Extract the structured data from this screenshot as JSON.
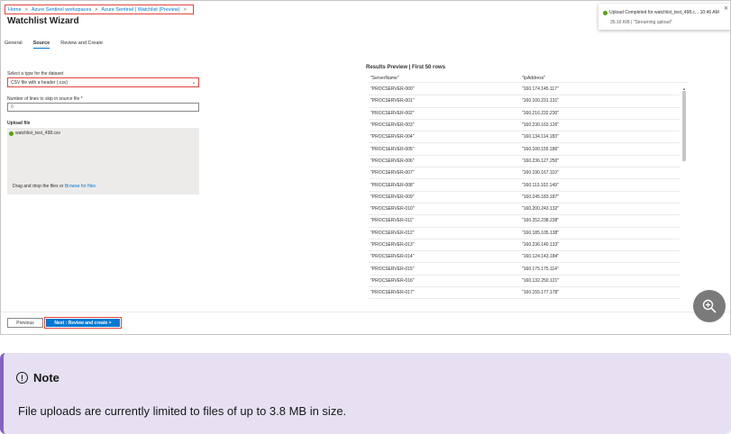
{
  "breadcrumb": [
    "Home",
    "Azure Sentinel workspaces",
    "Azure Sentinel | Watchlist (Preview)"
  ],
  "page_title": "Watchlist Wizard",
  "tabs": [
    {
      "label": "General",
      "active": false
    },
    {
      "label": "Source",
      "active": true
    },
    {
      "label": "Review and Create",
      "active": false
    }
  ],
  "form": {
    "type_label": "Select a type for the dataset",
    "type_value": "CSV file with a header (.csv)",
    "skip_label": "Number of lines to skip in source file *",
    "skip_value": "0",
    "upload_label": "Upload file",
    "uploaded_file": "watchlist_test_498.csv",
    "drop_text": "Drag and drop the files or",
    "browse_link": "Browse for files"
  },
  "results": {
    "title": "Results Preview | First 50 rows",
    "columns": [
      "\"ServerName\"",
      "\"IpAddress\""
    ],
    "rows": [
      [
        "\"PROCSERVER-000\"",
        "\"160.174.145.117\""
      ],
      [
        "\"PROCSERVER-001\"",
        "\"160.100.231.131\""
      ],
      [
        "\"PROCSERVER-002\"",
        "\"160.216.232.230\""
      ],
      [
        "\"PROCSERVER-003\"",
        "\"160.230.163.126\""
      ],
      [
        "\"PROCSERVER-004\"",
        "\"160.134.114.183\""
      ],
      [
        "\"PROCSERVER-005\"",
        "\"160.100.155.186\""
      ],
      [
        "\"PROCSERVER-006\"",
        "\"160.236.127.250\""
      ],
      [
        "\"PROCSERVER-007\"",
        "\"160.190.167.110\""
      ],
      [
        "\"PROCSERVER-008\"",
        "\"160.113.102.149\""
      ],
      [
        "\"PROCSERVER-009\"",
        "\"160.245.183.187\""
      ],
      [
        "\"PROCSERVER-010\"",
        "\"160.200.243.132\""
      ],
      [
        "\"PROCSERVER-011\"",
        "\"160.252.238.238\""
      ],
      [
        "\"PROCSERVER-012\"",
        "\"160.185.105.138\""
      ],
      [
        "\"PROCSERVER-013\"",
        "\"160.236.140.133\""
      ],
      [
        "\"PROCSERVER-014\"",
        "\"160.124.143.184\""
      ],
      [
        "\"PROCSERVER-015\"",
        "\"160.175.175.114\""
      ],
      [
        "\"PROCSERVER-016\"",
        "\"160.132.250.121\""
      ],
      [
        "\"PROCSERVER-017\"",
        "\"160.155.177.178\""
      ]
    ]
  },
  "footer": {
    "previous_label": "Previous",
    "next_label": "Next : Review and create >"
  },
  "toast": {
    "title": "Upload Completed for watchlist_test_498.c... 10:46 AM",
    "detail": "35.16 KiB | \"Streaming upload\""
  },
  "icons": {
    "zoom": "zoom-in-icon",
    "note": "info-icon"
  },
  "note": {
    "title": "Note",
    "icon_glyph": "!",
    "text": "File uploads are currently limited to files of up to 3.8 MB in size."
  },
  "colors": {
    "accent": "#0078d4",
    "highlight": "#e3453b",
    "note_bg": "#e7e0f3",
    "note_border": "#8661c5",
    "success": "#57a300"
  }
}
